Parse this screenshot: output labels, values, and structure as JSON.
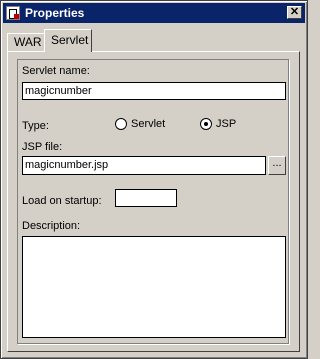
{
  "window": {
    "title": "Properties",
    "close_label": "✕"
  },
  "tabs": [
    {
      "label": "WAR",
      "selected": false
    },
    {
      "label": "Servlet",
      "selected": true
    }
  ],
  "form": {
    "servlet_name_label": "Servlet name:",
    "servlet_name_value": "magicnumber",
    "type_label": "Type:",
    "type_options": [
      {
        "label": "Servlet",
        "selected": false
      },
      {
        "label": "JSP",
        "selected": true
      }
    ],
    "jsp_file_label": "JSP file:",
    "jsp_file_value": "magicnumber.jsp",
    "browse_label": "...",
    "load_on_startup_label": "Load on startup:",
    "load_on_startup_value": "",
    "description_label": "Description:",
    "description_value": ""
  },
  "icons": {
    "window_icon": "properties-document-icon"
  }
}
